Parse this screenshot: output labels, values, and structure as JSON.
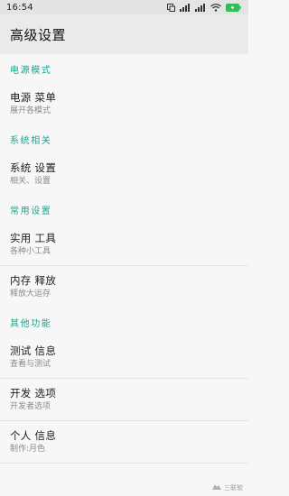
{
  "status_bar": {
    "time": "16:54",
    "battery_color": "#2ebd59"
  },
  "title": "高级设置",
  "accent_color": "#19a58f",
  "sections": [
    {
      "header": "电源模式",
      "items": [
        {
          "title": "电源 菜单",
          "subtitle": "展开各模式"
        }
      ]
    },
    {
      "header": "系统相关",
      "items": [
        {
          "title": "系统 设置",
          "subtitle": "相关、设置"
        }
      ]
    },
    {
      "header": "常用设置",
      "items": [
        {
          "title": "实用 工具",
          "subtitle": "各种小工具"
        },
        {
          "title": "内存 释放",
          "subtitle": "释放大运存"
        }
      ]
    },
    {
      "header": "其他功能",
      "items": [
        {
          "title": "测试 信息",
          "subtitle": "查看与测试"
        },
        {
          "title": "开发 选项",
          "subtitle": "开发者选项"
        },
        {
          "title": "个人 信息",
          "subtitle": "制作:月色"
        }
      ]
    }
  ],
  "watermark": {
    "text": "三联软"
  }
}
